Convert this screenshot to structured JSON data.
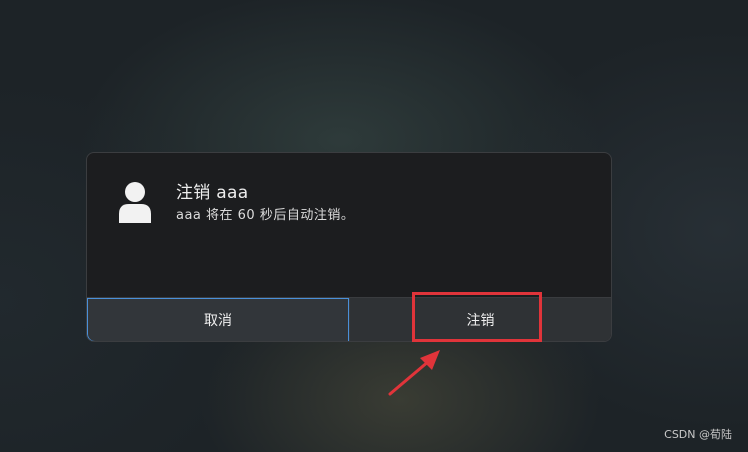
{
  "dialog": {
    "title": "注销 aaa",
    "message": "aaa 将在 60 秒后自动注销。",
    "buttons": {
      "cancel_label": "取消",
      "logout_label": "注销"
    }
  },
  "annotation": {
    "color": "#e0343a"
  },
  "watermark": "CSDN @荀陆",
  "colors": {
    "focus_border": "#4a90d9",
    "dialog_bg": "#1c1d1f"
  }
}
